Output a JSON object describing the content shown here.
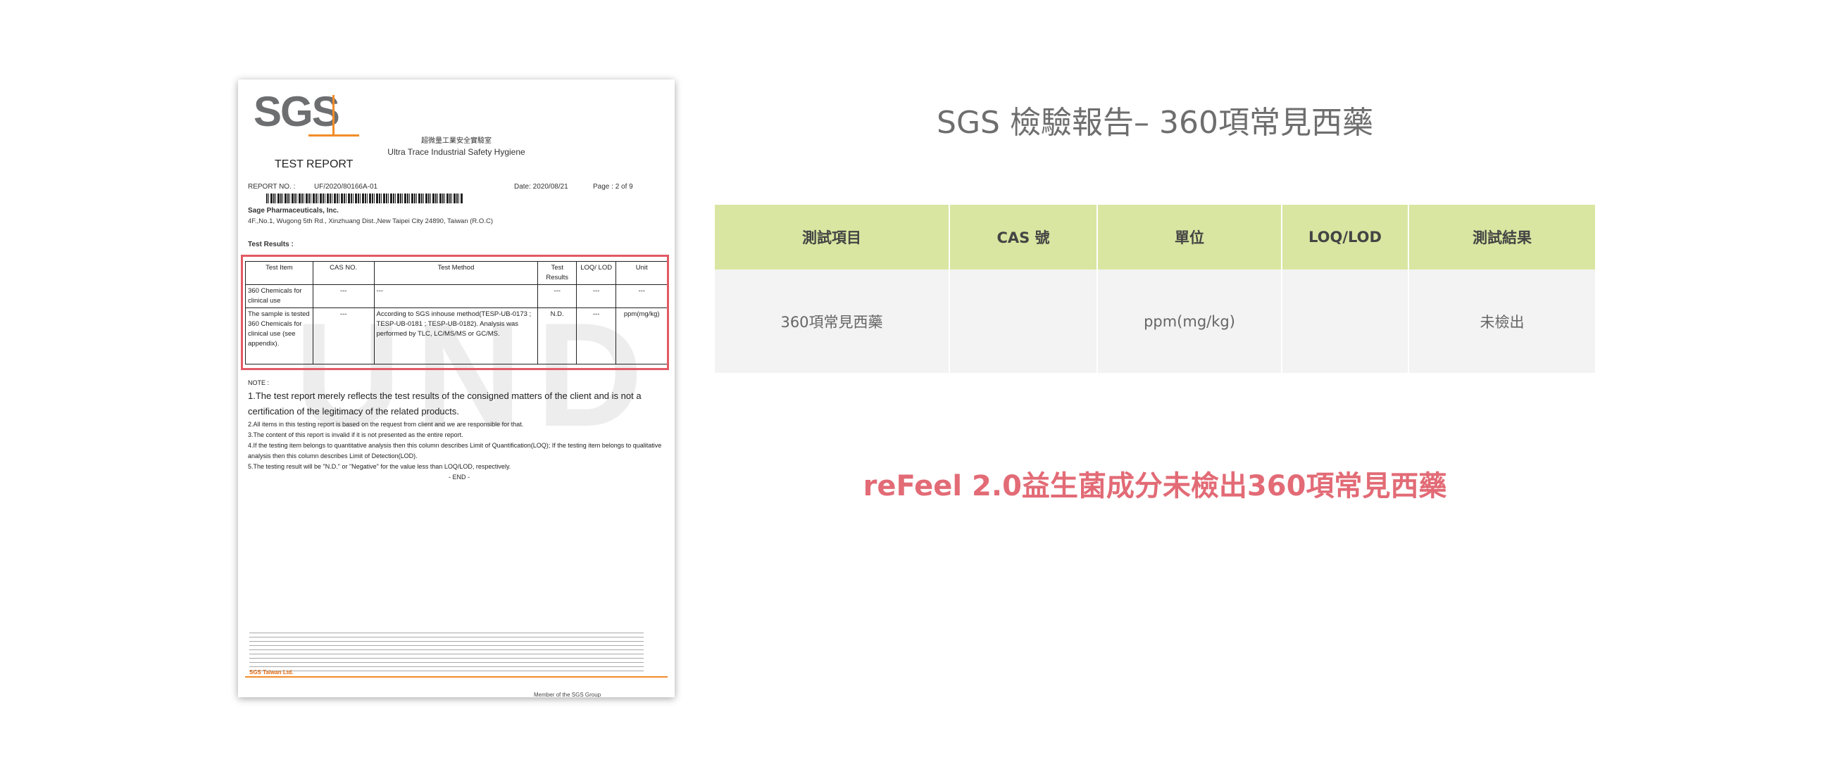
{
  "report": {
    "logo": "SGS",
    "lab_name_cn": "超微量工業安全實驗室",
    "lab_name_en": "Ultra Trace Industrial Safety Hygiene",
    "title": "TEST REPORT",
    "report_no_label": "REPORT NO. :",
    "report_no": "UF/2020/80166A-01",
    "date": "Date:  2020/08/21",
    "page": "Page  : 2 of 9",
    "company": "Sage Pharmaceuticals, Inc.",
    "address": "4F.,No.1, Wugong 5th Rd., Xinzhuang Dist.,New Taipei City 24890, Taiwan (R.O.C)",
    "test_results_label": "Test Results :",
    "table": {
      "headers": [
        "Test Item",
        "CAS NO.",
        "Test Method",
        "Test Results",
        "LOQ/ LOD",
        "Unit"
      ],
      "row1": [
        "360 Chemicals for clinical use",
        "---",
        "---",
        "---",
        "---",
        "---"
      ],
      "row2": [
        "The sample is tested 360 Chemicals for clinical use (see appendix).",
        "---",
        "According to SGS inhouse method(TESP-UB-0173 ; TESP-UB-0181 ; TESP-UB-0182). Analysis was performed by TLC, LC/MS/MS or GC/MS.",
        "N.D.",
        "---",
        "ppm(mg/kg)"
      ]
    },
    "watermark": "UND",
    "note_label": "NOTE :",
    "notes": [
      "1.The test report merely reflects the test results of the consigned matters  of the client and is not a certification of the legitimacy of the related products.",
      "2.All items in this testing report is based on the request from client and we are responsible for that.",
      "3.The content of this report is invalid if it is not presented as the entire report.",
      "4.If the testing item belongs to quantitative analysis then this column describes Limit of Quantification(LOQ); If the testing item belongs to qualitative analysis then this column describes Limit of Detection(LOD).",
      "5.The testing result will be \"N.D.\" or \"Negative\" for the value less than LOQ/LOD, respectively."
    ],
    "end": "- END -",
    "footer_company": "SGS Taiwan Ltd.",
    "footer_member": "Member of the SGS Group"
  },
  "heading": "SGS 檢驗報告– 360項常見西藥",
  "summary_table": {
    "headers": [
      "測試項目",
      "CAS 號",
      "單位",
      "LOQ/LOD",
      "測試結果"
    ],
    "row": [
      "360項常見西藥",
      "",
      "ppm(mg/kg)",
      "",
      "未檢出"
    ]
  },
  "tagline": "reFeel 2.0益生菌成分未檢出360項常見西藥",
  "colors": {
    "header_bg": "#d9e6a1",
    "row_bg": "#f3f3f3",
    "tagline": "#e26b76",
    "highlight_border": "#e25a64",
    "sgs_orange": "#f28c28"
  }
}
